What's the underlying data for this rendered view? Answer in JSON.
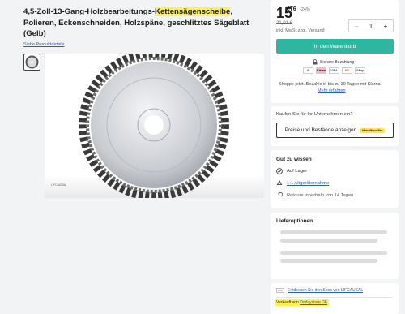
{
  "product": {
    "title_before": "4,5-Zoll-13-Gang-Holzbearbeitungs-",
    "title_highlight": "Kettensägenscheibe",
    "title_after": ", Polieren, Eckenschneiden, Holzspäne, geschlitztes Sägeblatt (Gelb)",
    "details_link": "Siehe Produktdetails",
    "brand_mark": "LIFCAUSAL"
  },
  "price": {
    "main": "15",
    "cents": "€76",
    "discount": "-24%",
    "old": "21,01 €",
    "vat": "inkl. MwSt.zzgl. Versand",
    "quantity": "1",
    "minus": "−",
    "plus": "+"
  },
  "cart": {
    "button_label": "In den Warenkorb"
  },
  "payment": {
    "secure_label": "Sichere Bezahlung",
    "methods": [
      "P",
      "Klarna",
      "VISA",
      "MC",
      "GPay"
    ],
    "klarna_text": "Shoppe jetzt. Bezahle in bis zu 30 Tagen mit Klarna",
    "more_link": "Mehr erfahren"
  },
  "business": {
    "question": "Kaufen Sie für Ihr Unternehmen ein?",
    "button_label": "Preise und Bestände anzeigen",
    "badge": "ManoMano Pro"
  },
  "good_to_know": {
    "title": "Gut zu wissen",
    "items": [
      {
        "label": "Auf Lager",
        "icon": "check-circle-icon"
      },
      {
        "label": "1:1 Altgeräternahme",
        "icon": "recycle-icon"
      },
      {
        "label": "Retoure innerhalb von 14 Tagen",
        "icon": "return-arrow-icon"
      }
    ]
  },
  "delivery": {
    "title": "Lieferoptionen"
  },
  "seller": {
    "shop_link": "Entdecken Sie den Shop von LIFCAUSAL",
    "sold_by_prefix": "Verkauft von",
    "sold_by_link": "Dodaystore DE"
  },
  "colors": {
    "accent": "#2db6a0",
    "highlight": "#fff24a",
    "link": "#2d5fb0"
  }
}
